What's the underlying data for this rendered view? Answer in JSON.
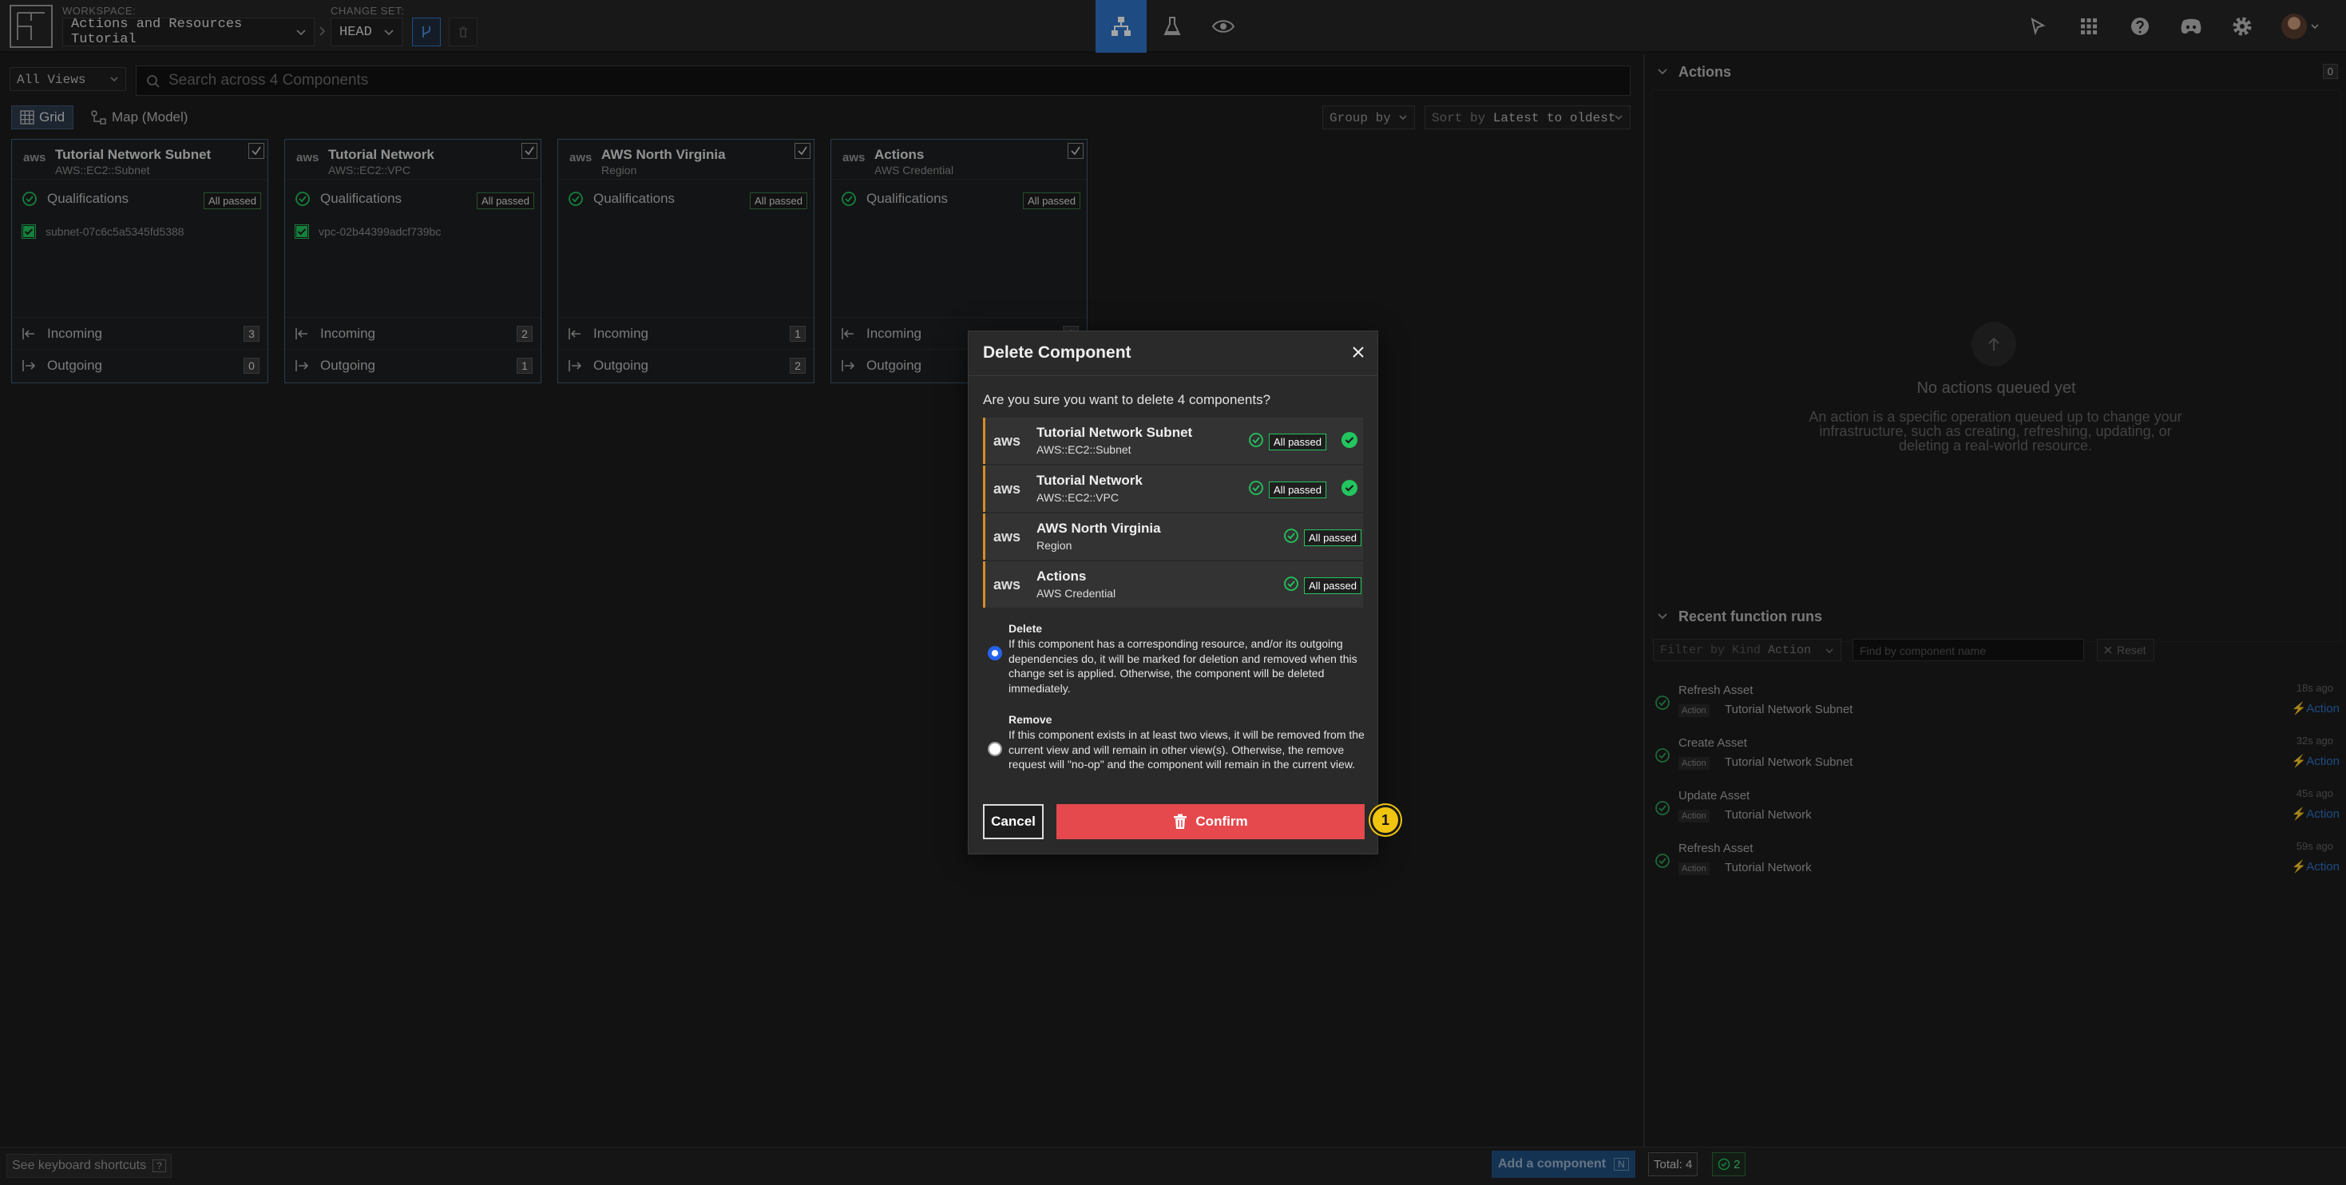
{
  "topbar": {
    "workspace_label": "WORKSPACE:",
    "workspace_name": "Actions and Resources Tutorial",
    "changeset_label": "CHANGE SET:",
    "changeset_name": "HEAD"
  },
  "toolbar": {
    "view_select": "All Views",
    "search_placeholder": "Search across 4 Components",
    "grid_tab": "Grid",
    "map_tab": "Map (Model)",
    "group_by": "Group by",
    "sort_prefix": "Sort by",
    "sort_value": "Latest to oldest"
  },
  "cards": [
    {
      "title": "Tutorial Network Subnet",
      "subtitle": "AWS::EC2::Subnet",
      "qual": "Qualifications",
      "badge": "All passed",
      "resource": "subnet-07c6c5a5345fd5388",
      "incoming": "Incoming",
      "incoming_count": "3",
      "outgoing": "Outgoing",
      "outgoing_count": "0"
    },
    {
      "title": "Tutorial Network",
      "subtitle": "AWS::EC2::VPC",
      "qual": "Qualifications",
      "badge": "All passed",
      "resource": "vpc-02b44399adcf739bc",
      "incoming": "Incoming",
      "incoming_count": "2",
      "outgoing": "Outgoing",
      "outgoing_count": "1"
    },
    {
      "title": "AWS North Virginia",
      "subtitle": "Region",
      "qual": "Qualifications",
      "badge": "All passed",
      "resource": "",
      "incoming": "Incoming",
      "incoming_count": "1",
      "outgoing": "Outgoing",
      "outgoing_count": "2"
    },
    {
      "title": "Actions",
      "subtitle": "AWS Credential",
      "qual": "Qualifications",
      "badge": "All passed",
      "resource": "",
      "incoming": "Incoming",
      "incoming_count": "1",
      "outgoing": "Outgoing",
      "outgoing_count": ""
    }
  ],
  "actions_panel": {
    "title": "Actions",
    "count": "0",
    "empty_title": "No actions queued yet",
    "empty_desc": "An action is a specific operation queued up to change your infrastructure, such as creating, refreshing, updating, or deleting a real-world resource."
  },
  "function_runs": {
    "title": "Recent function runs",
    "filter_prefix": "Filter by Kind",
    "filter_value": "Action",
    "name_placeholder": "Find by component name",
    "reset": "Reset",
    "items": [
      {
        "name": "Refresh Asset",
        "kind": "Action",
        "component": "Tutorial Network Subnet",
        "time": "18s ago",
        "action": "Action"
      },
      {
        "name": "Create Asset",
        "kind": "Action",
        "component": "Tutorial Network Subnet",
        "time": "32s ago",
        "action": "Action"
      },
      {
        "name": "Update Asset",
        "kind": "Action",
        "component": "Tutorial Network",
        "time": "45s ago",
        "action": "Action"
      },
      {
        "name": "Refresh Asset",
        "kind": "Action",
        "component": "Tutorial Network",
        "time": "59s ago",
        "action": "Action"
      }
    ]
  },
  "bottombar": {
    "shortcuts": "See keyboard shortcuts",
    "shortcuts_key": "?",
    "add_component": "Add a component",
    "add_key": "N",
    "total": "Total: 4",
    "passed": "2"
  },
  "modal": {
    "title": "Delete Component",
    "question": "Are you sure you want to delete 4 components?",
    "rows": [
      {
        "title": "Tutorial Network Subnet",
        "subtitle": "AWS::EC2::Subnet",
        "badge": "All passed"
      },
      {
        "title": "Tutorial Network",
        "subtitle": "AWS::EC2::VPC",
        "badge": "All passed"
      },
      {
        "title": "AWS North Virginia",
        "subtitle": "Region",
        "badge": "All passed"
      },
      {
        "title": "Actions",
        "subtitle": "AWS Credential",
        "badge": "All passed"
      }
    ],
    "aws": "aws",
    "delete_title": "Delete",
    "delete_desc": "If this component has a corresponding resource, and/or its outgoing dependencies do, it will be marked for deletion and removed when this change set is applied. Otherwise, the component will be deleted immediately.",
    "remove_title": "Remove",
    "remove_desc": "If this component exists in at least two views, it will be removed from the current view and will remain in other view(s). Otherwise, the remove request will \"no-op\" and the component will remain in the current view.",
    "cancel": "Cancel",
    "confirm": "Confirm"
  },
  "marker": "1",
  "colors": {
    "accent": "#2f74c8",
    "danger": "#e5484d",
    "success": "#22c55e",
    "warning": "#d68c26",
    "marker": "#f1c40f"
  }
}
